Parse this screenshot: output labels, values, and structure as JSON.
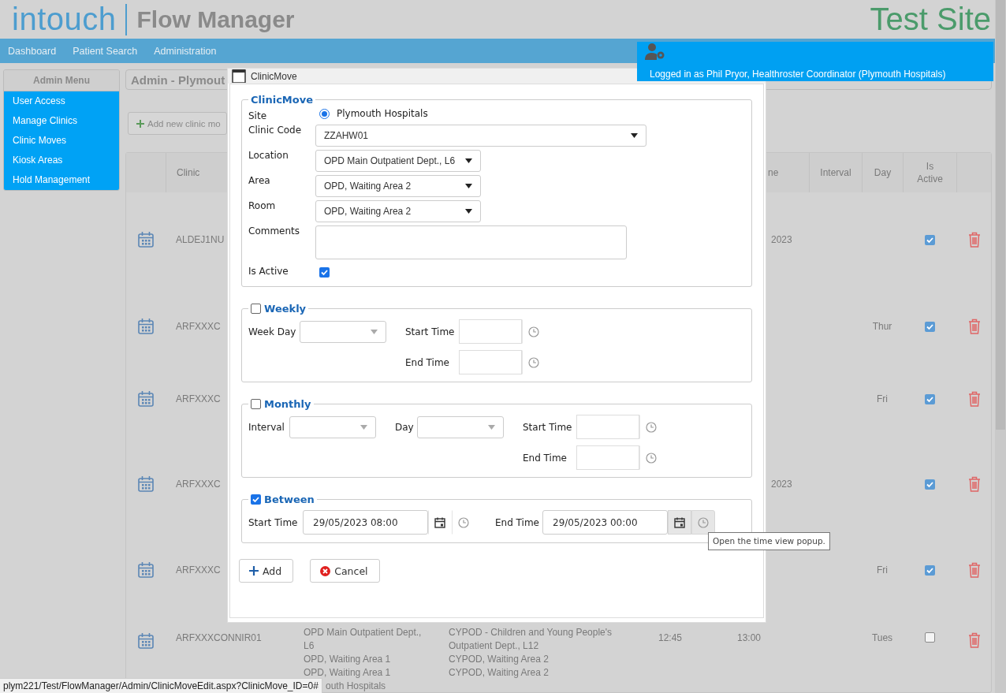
{
  "header": {
    "logo": "intouch",
    "product": "Flow Manager",
    "site": "Test Site"
  },
  "nav": [
    {
      "label": "Dashboard"
    },
    {
      "label": "Patient Search"
    },
    {
      "label": "Administration"
    }
  ],
  "user_panel": {
    "text": "Logged in as Phil Pryor, Healthroster Coordinator (Plymouth Hospitals)"
  },
  "admin_menu": {
    "title": "Admin Menu",
    "items": [
      {
        "label": "User Access"
      },
      {
        "label": "Manage Clinics"
      },
      {
        "label": "Clinic Moves"
      },
      {
        "label": "Kiosk Areas"
      },
      {
        "label": "Hold Management"
      }
    ]
  },
  "panel_title": "Admin - Plymout",
  "add_button": "Add new clinic mo",
  "table": {
    "columns": {
      "clinic": "Clinic",
      "end": "ne",
      "interval": "Interval",
      "day": "Day",
      "is_active": "Is Active"
    },
    "rows": [
      {
        "clinic": "ALDEJ1NU",
        "end": "2023",
        "is_active": true
      },
      {
        "clinic": "ARFXXXC",
        "day": "Thur",
        "is_active": true
      },
      {
        "clinic": "ARFXXXC",
        "day": "Fri",
        "is_active": true
      },
      {
        "clinic": "ARFXXXC",
        "end": "2023",
        "is_active": true
      },
      {
        "clinic": "ARFXXXC",
        "day": "Fri",
        "is_active": true
      },
      {
        "clinic": "ARFXXXCONNIR01",
        "from": [
          "OPD Main Outpatient Dept., L6",
          "OPD, Waiting Area 1",
          "OPD, Waiting Area 1",
          "outh Hospitals"
        ],
        "to": [
          "CYPOD - Children and Young People's Outpatient Dept., L12",
          "CYPOD, Waiting Area 2",
          "CYPOD, Waiting Area 2"
        ],
        "start": "12:45",
        "end": "13:00",
        "day": "Tues",
        "is_active": false
      }
    ]
  },
  "dialog": {
    "title": "ClinicMove",
    "details": {
      "legend": "ClinicMove",
      "site": {
        "label": "Site",
        "option": "Plymouth Hospitals",
        "selected": true
      },
      "selects": [
        {
          "label": "Clinic Code",
          "value": "ZZAHW01",
          "kind": "wide"
        },
        {
          "label": "Location",
          "value": "OPD Main Outpatient Dept., L6",
          "kind": "narrow"
        },
        {
          "label": "Area",
          "value": "OPD, Waiting Area 2",
          "kind": "narrow"
        },
        {
          "label": "Room",
          "value": "OPD, Waiting Area 2",
          "kind": "narrow"
        }
      ],
      "comments": {
        "label": "Comments"
      },
      "is_active": {
        "label": "Is Active",
        "checked": true
      }
    },
    "weekly": {
      "legend": "Weekly",
      "checked": false,
      "week_day": "Week Day",
      "start_time": "Start Time",
      "end_time": "End Time"
    },
    "monthly": {
      "legend": "Monthly",
      "checked": false,
      "interval": "Interval",
      "day": "Day",
      "start_time": "Start Time",
      "end_time": "End Time"
    },
    "between": {
      "legend": "Between",
      "checked": true,
      "fields": [
        {
          "label": "Start Time",
          "value": "29/05/2023 08:00",
          "hovered": false
        },
        {
          "label": "End Time",
          "value": "29/05/2023 00:00",
          "hovered": true
        }
      ]
    },
    "buttons": [
      {
        "kind": "add",
        "label": "Add"
      },
      {
        "kind": "cancel",
        "label": "Cancel"
      }
    ]
  },
  "tooltip": "Open the time view popup.",
  "status_bar": "plym221/Test/FlowManager/Admin/ClinicMoveEdit.aspx?ClinicMove_ID=0#"
}
